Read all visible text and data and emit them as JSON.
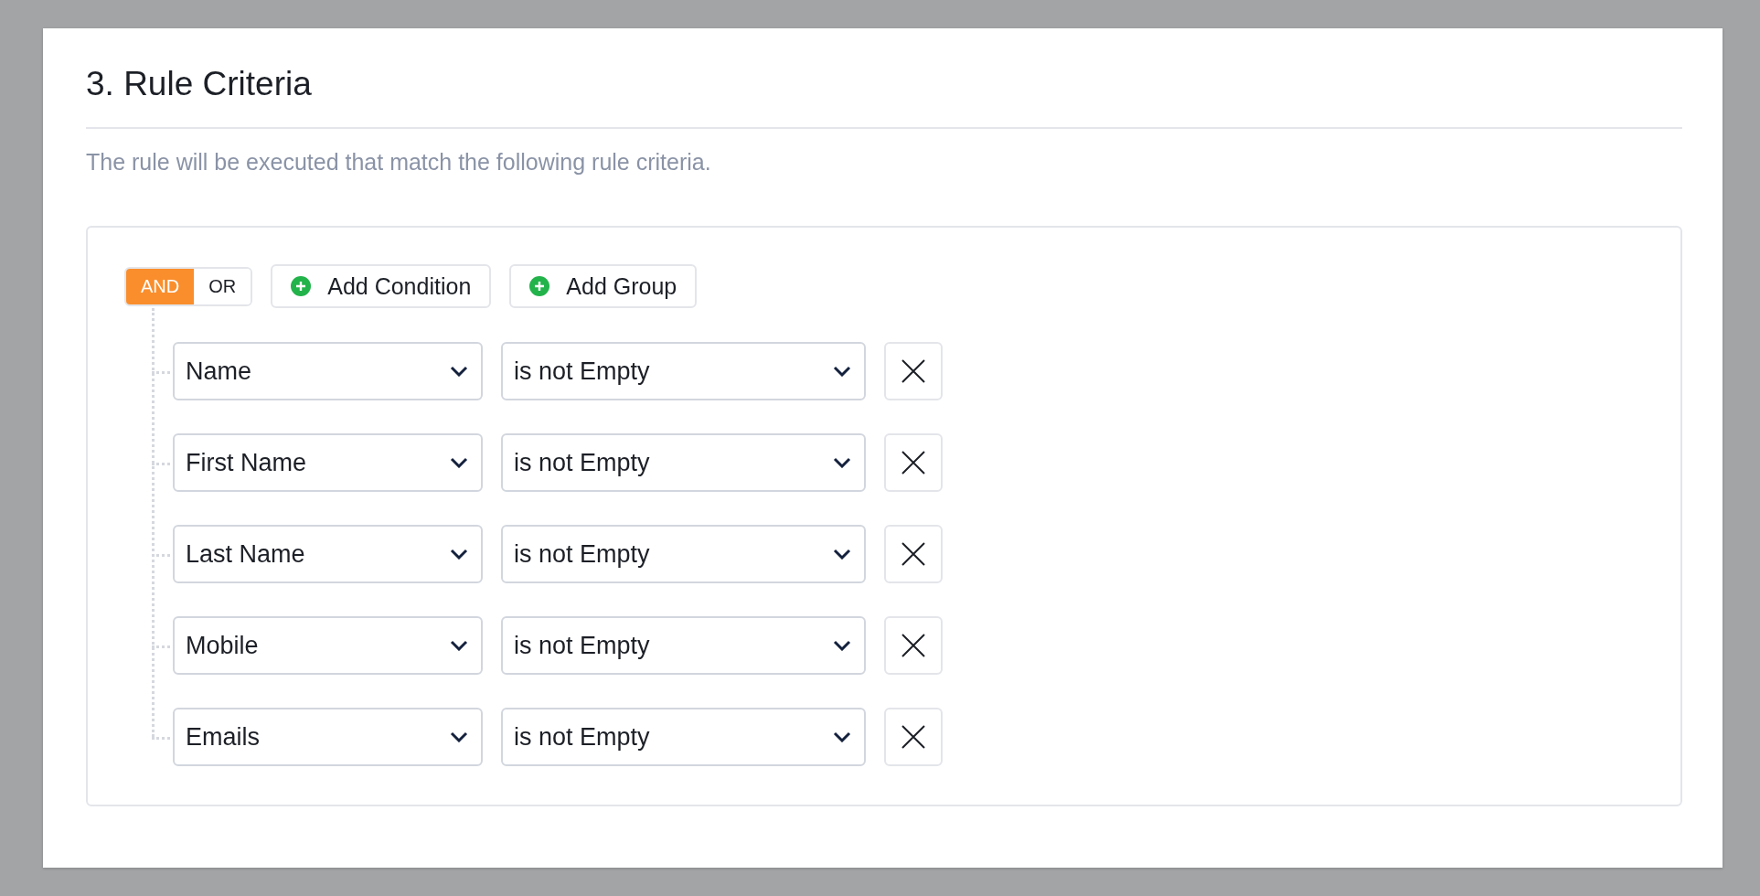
{
  "section": {
    "title": "3. Rule Criteria",
    "description": "The rule will be executed that match the following rule criteria."
  },
  "logic": [
    {
      "label": "AND",
      "selected": true
    },
    {
      "label": "OR",
      "selected": false
    }
  ],
  "actions": [
    {
      "label": "Add Condition"
    },
    {
      "label": "Add Group"
    }
  ],
  "conditions": [
    {
      "field": "Name",
      "operator": "is not Empty"
    },
    {
      "field": "First Name",
      "operator": "is not Empty"
    },
    {
      "field": "Last Name",
      "operator": "is not Empty"
    },
    {
      "field": "Mobile",
      "operator": "is not Empty"
    },
    {
      "field": "Emails",
      "operator": "is not Empty"
    }
  ]
}
